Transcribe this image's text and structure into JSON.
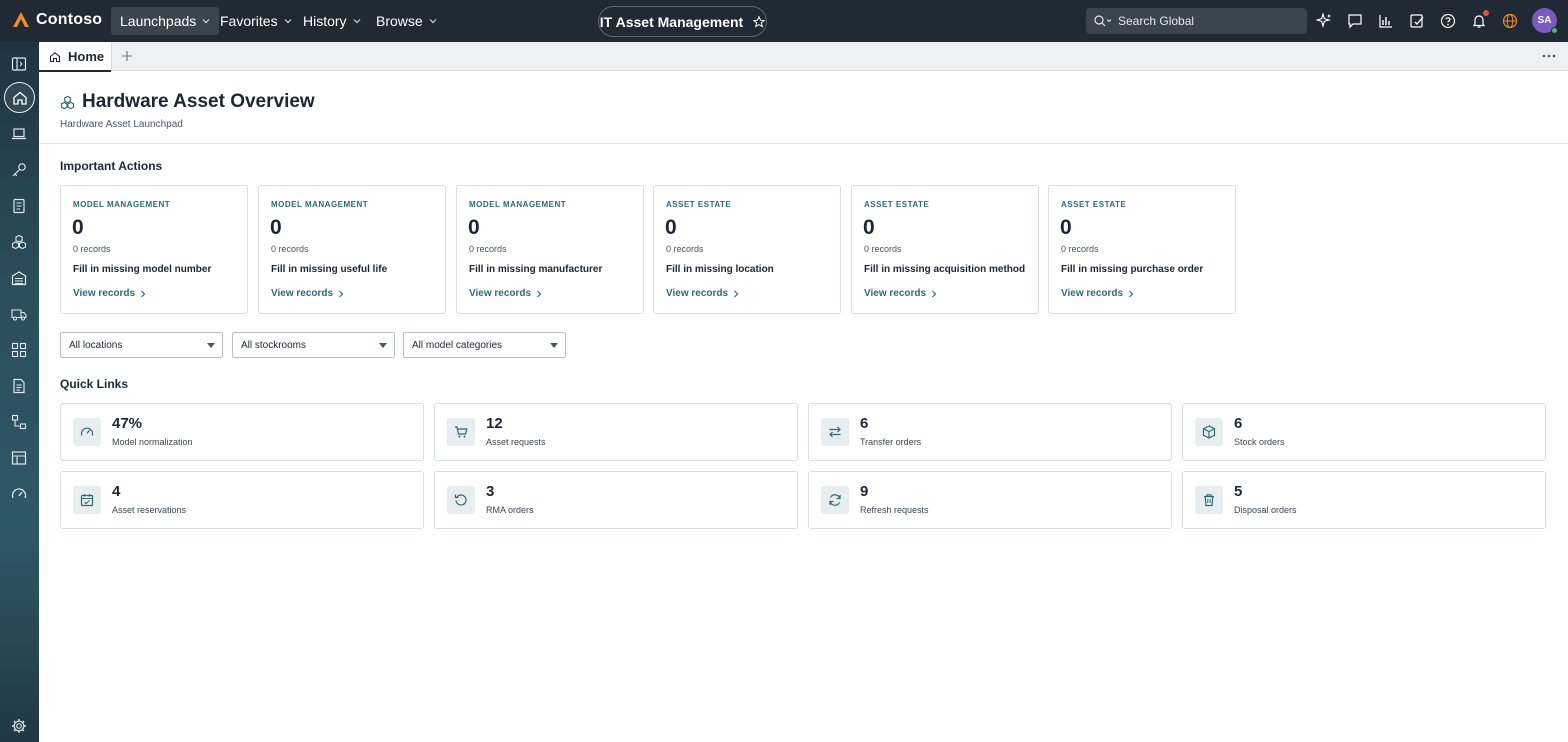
{
  "brand": {
    "name": "Contoso"
  },
  "topnav": {
    "menus": [
      {
        "label": "Launchpads"
      },
      {
        "label": "Favorites"
      },
      {
        "label": "History"
      },
      {
        "label": "Browse"
      }
    ],
    "app_name": "IT Asset Management",
    "search_placeholder": "Search Global",
    "user_initials": "SA"
  },
  "tabs": {
    "home_label": "Home"
  },
  "page": {
    "title": "Hardware Asset Overview",
    "subtitle": "Hardware Asset Launchpad"
  },
  "important_actions": {
    "title": "Important Actions",
    "cards": [
      {
        "category": "MODEL MANAGEMENT",
        "value": "0",
        "records": "0 records",
        "description": "Fill in missing model number",
        "link": "View records"
      },
      {
        "category": "MODEL MANAGEMENT",
        "value": "0",
        "records": "0 records",
        "description": "Fill in missing useful life",
        "link": "View records"
      },
      {
        "category": "MODEL MANAGEMENT",
        "value": "0",
        "records": "0 records",
        "description": "Fill in missing manufacturer",
        "link": "View records"
      },
      {
        "category": "ASSET ESTATE",
        "value": "0",
        "records": "0 records",
        "description": "Fill in missing location",
        "link": "View records"
      },
      {
        "category": "ASSET ESTATE",
        "value": "0",
        "records": "0 records",
        "description": "Fill in missing acquisition method",
        "link": "View records"
      },
      {
        "category": "ASSET ESTATE",
        "value": "0",
        "records": "0 records",
        "description": "Fill in missing purchase order",
        "link": "View records"
      }
    ]
  },
  "filters": [
    {
      "selected": "All locations"
    },
    {
      "selected": "All stockrooms"
    },
    {
      "selected": "All model categories"
    }
  ],
  "quick_links": {
    "title": "Quick Links",
    "items": [
      {
        "value": "47%",
        "label": "Model normalization",
        "icon": "gauge-icon"
      },
      {
        "value": "12",
        "label": "Asset requests",
        "icon": "cart-icon"
      },
      {
        "value": "6",
        "label": "Transfer orders",
        "icon": "transfer-icon"
      },
      {
        "value": "6",
        "label": "Stock orders",
        "icon": "box-icon"
      },
      {
        "value": "4",
        "label": "Asset reservations",
        "icon": "calendar-check-icon"
      },
      {
        "value": "3",
        "label": "RMA orders",
        "icon": "undo-icon"
      },
      {
        "value": "9",
        "label": "Refresh requests",
        "icon": "refresh-icon"
      },
      {
        "value": "5",
        "label": "Disposal orders",
        "icon": "trash-icon"
      }
    ]
  },
  "colors": {
    "topbar": "#1f2a34",
    "accent": "#2e6b77",
    "siderail": "#2b4e5c"
  }
}
